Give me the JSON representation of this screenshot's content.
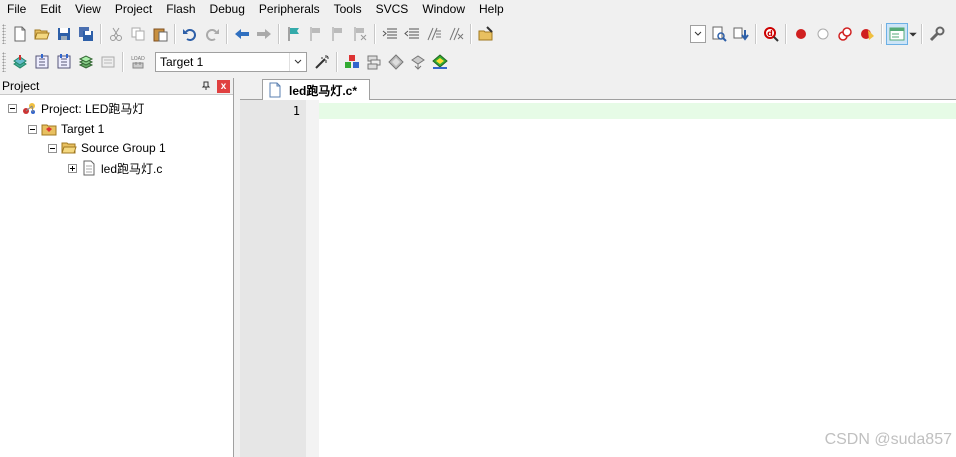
{
  "menu": [
    "File",
    "Edit",
    "View",
    "Project",
    "Flash",
    "Debug",
    "Peripherals",
    "Tools",
    "SVCS",
    "Window",
    "Help"
  ],
  "toolbar2": {
    "target_value": "Target 1"
  },
  "project_panel": {
    "title": "Project",
    "close_glyph": "x",
    "tree": {
      "project": "Project: LED跑马灯",
      "target": "Target 1",
      "group": "Source Group 1",
      "file": "led跑马灯.c"
    }
  },
  "editor": {
    "tab_label": "led跑马灯.c*",
    "line_number": "1",
    "current_line_color": "#e6fbe6"
  },
  "watermark": "CSDN @suda857"
}
